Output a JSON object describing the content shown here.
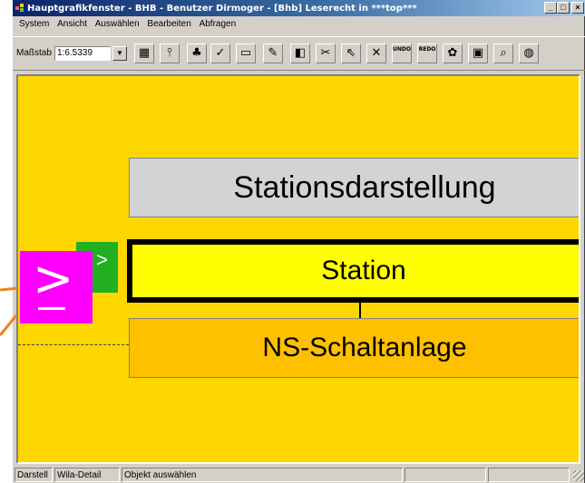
{
  "window": {
    "title": "Hauptgrafikfenster - BHB - Benutzer Dirmoger  -  [Bhb] Leserecht in ***top***",
    "min_label": "_",
    "max_label": "□",
    "close_label": "×"
  },
  "menu": {
    "items": [
      {
        "label": "System"
      },
      {
        "label": "Ansicht"
      },
      {
        "label": "Auswählen"
      },
      {
        "label": "Bearbeiten"
      },
      {
        "label": "Abfragen"
      }
    ]
  },
  "toolbar": {
    "scale_label": "Maßstab",
    "scale_value": "1:6.5339",
    "scale_arrow": "▼",
    "buttons": [
      {
        "icon": "layers-icon",
        "glyph": "▦"
      },
      {
        "icon": "pin-icon",
        "glyph": "⫯"
      },
      {
        "icon": "tree-icon",
        "glyph": "♣"
      },
      {
        "icon": "check-icon",
        "glyph": "✓"
      },
      {
        "icon": "monitor-icon",
        "glyph": "▭"
      },
      {
        "icon": "palette-icon",
        "glyph": "✎"
      },
      {
        "icon": "map-icon",
        "glyph": "◧"
      },
      {
        "icon": "scissors-icon",
        "glyph": "✂"
      },
      {
        "icon": "cursor-icon",
        "glyph": "⇖"
      },
      {
        "icon": "close-icon",
        "glyph": "✕"
      },
      {
        "icon": "undo-icon",
        "glyph": "UNDO"
      },
      {
        "icon": "redo-icon",
        "glyph": "REDO"
      },
      {
        "icon": "paint-icon",
        "glyph": "✿"
      },
      {
        "icon": "grid-icon",
        "glyph": "▣"
      },
      {
        "icon": "search-icon",
        "glyph": "⌕"
      },
      {
        "icon": "globe-icon",
        "glyph": "◍"
      }
    ]
  },
  "canvas": {
    "box_top": "Stationsdarstellung",
    "box_station": "Station",
    "box_ns": "NS-Schaltanlage",
    "green_marker": ">",
    "colors": {
      "background": "#ffd700",
      "station_fill": "#ffff00",
      "ns_fill": "#ffc000",
      "grey_fill": "#d3d3d3"
    }
  },
  "overlay": {
    "magenta_glyph": ">",
    "magenta_color": "#ff00ff",
    "arrow_color": "#f08020"
  },
  "statusbar": {
    "cell1": "Darstell",
    "cell2": "Wila-Detail",
    "cell3": "Objekt auswählen",
    "cell4": "",
    "cell5": ""
  }
}
